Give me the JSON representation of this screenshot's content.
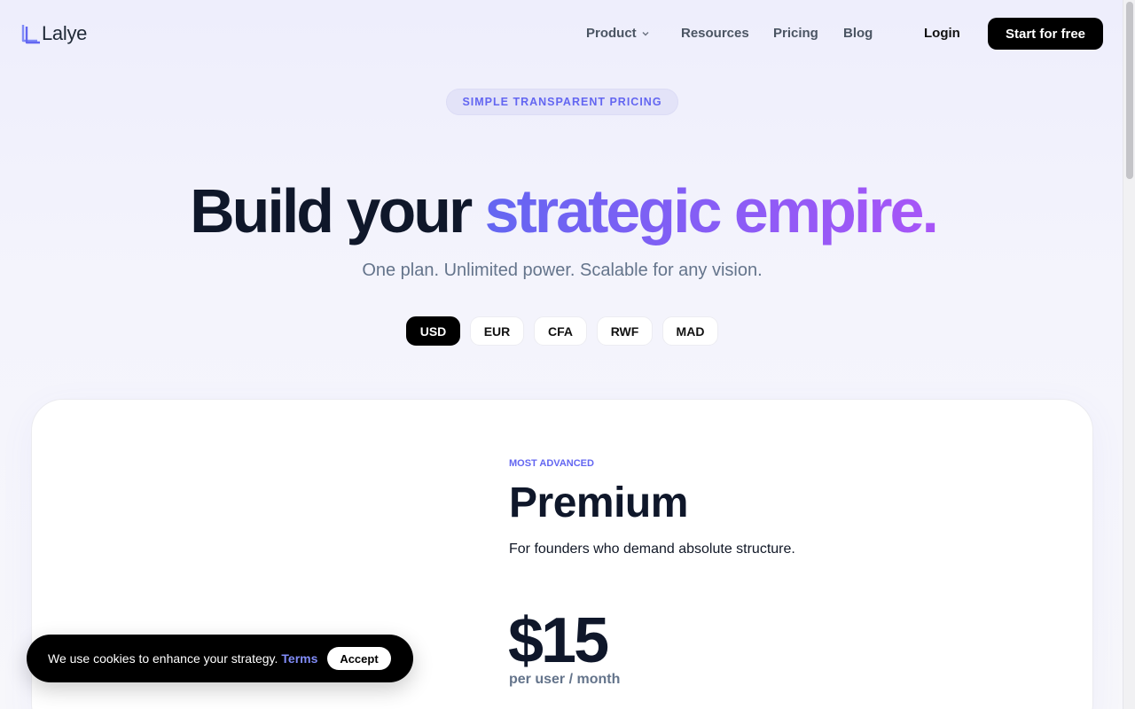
{
  "brand": {
    "name": "Lalye",
    "accent": "#6366f1"
  },
  "nav": {
    "items": [
      {
        "label": "Product",
        "has_dropdown": true
      },
      {
        "label": "Resources"
      },
      {
        "label": "Pricing"
      },
      {
        "label": "Blog"
      }
    ],
    "login_label": "Login",
    "cta_label": "Start for free"
  },
  "badge": "SIMPLE TRANSPARENT PRICING",
  "hero": {
    "title_plain": "Build your ",
    "title_gradient": "strategic empire.",
    "subtitle": "One plan. Unlimited power. Scalable for any vision."
  },
  "currencies": {
    "options": [
      "USD",
      "EUR",
      "CFA",
      "RWF",
      "MAD"
    ],
    "selected": "USD"
  },
  "plan": {
    "label": "MOST ADVANCED",
    "name": "Premium",
    "description": "For founders who demand absolute structure.",
    "price": "$15",
    "unit": "per user / month"
  },
  "cookie": {
    "text": "We use cookies to enhance your strategy.",
    "link": "Terms",
    "accept": "Accept"
  }
}
